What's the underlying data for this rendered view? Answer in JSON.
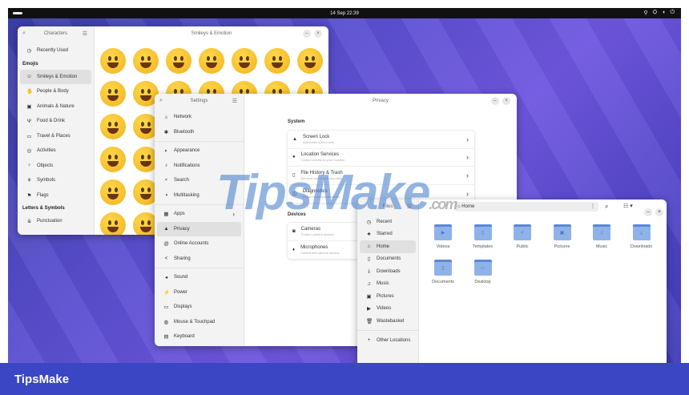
{
  "topbar": {
    "datetime": "14 Sep  22:39",
    "tray": [
      "⚲",
      "⛭",
      "◖",
      "⏻"
    ]
  },
  "characters": {
    "title": "Characters",
    "header": "Smileys & Emotion",
    "recent": "Recently Used",
    "emojis_section": "Emojis",
    "items": [
      {
        "icon": "☺",
        "label": "Smileys & Emotion"
      },
      {
        "icon": "✋",
        "label": "People & Body"
      },
      {
        "icon": "▣",
        "label": "Animals & Nature"
      },
      {
        "icon": "Ψ",
        "label": "Food & Drink"
      },
      {
        "icon": "▭",
        "label": "Travel & Places"
      },
      {
        "icon": "◎",
        "label": "Activities"
      },
      {
        "icon": "♀",
        "label": "Objects"
      },
      {
        "icon": "⚘",
        "label": "Symbols"
      },
      {
        "icon": "⚑",
        "label": "Flags"
      }
    ],
    "letters_section": "Letters & Symbols",
    "punct": "Punctuation"
  },
  "settings": {
    "title": "Settings",
    "header": "Privacy",
    "groups": [
      [
        {
          "icon": "⌂",
          "label": "Network"
        },
        {
          "icon": "✱",
          "label": "Bluetooth"
        }
      ],
      [
        {
          "icon": "◐",
          "label": "Appearance"
        },
        {
          "icon": "♪",
          "label": "Notifications"
        },
        {
          "icon": "⌕",
          "label": "Search"
        },
        {
          "icon": "◑",
          "label": "Multitasking"
        }
      ],
      [
        {
          "icon": "▦",
          "label": "Apps",
          "chev": "›"
        },
        {
          "icon": "▲",
          "label": "Privacy"
        },
        {
          "icon": "@",
          "label": "Online Accounts"
        },
        {
          "icon": "<",
          "label": "Sharing"
        }
      ],
      [
        {
          "icon": "◂",
          "label": "Sound"
        },
        {
          "icon": "⚡",
          "label": "Power"
        },
        {
          "icon": "▭",
          "label": "Displays"
        },
        {
          "icon": "◍",
          "label": "Mouse & Touchpad"
        },
        {
          "icon": "▤",
          "label": "Keyboard"
        }
      ]
    ],
    "system_label": "System",
    "system": [
      {
        "icon": "▲",
        "title": "Screen Lock",
        "sub": "Automatic screen lock"
      },
      {
        "icon": "●",
        "title": "Location Services",
        "sub": "Control access to your location"
      },
      {
        "icon": "▯",
        "title": "File History & Trash",
        "sub": "Remove saved data and files"
      },
      {
        "icon": "◫",
        "title": "Diagnostics",
        "sub": "Report technical problems"
      }
    ],
    "devices_label": "Devices",
    "devices": [
      {
        "icon": "◙",
        "title": "Cameras",
        "sub": "Control camera access"
      },
      {
        "icon": "♦",
        "title": "Microphones",
        "sub": "Control microphone access"
      }
    ]
  },
  "files": {
    "title": "Files",
    "path": "Home",
    "sidebar": [
      {
        "icon": "◷",
        "label": "Recent"
      },
      {
        "icon": "★",
        "label": "Starred"
      },
      {
        "icon": "⌂",
        "label": "Home"
      },
      {
        "icon": "▯",
        "label": "Documents"
      },
      {
        "icon": "⤓",
        "label": "Downloads"
      },
      {
        "icon": "♫",
        "label": "Music"
      },
      {
        "icon": "▣",
        "label": "Pictures"
      },
      {
        "icon": "▶",
        "label": "Videos"
      },
      {
        "icon": "🗑",
        "label": "Wastebasket"
      }
    ],
    "other": "Other Locations",
    "folders": [
      {
        "icon": "▶",
        "label": "Videos"
      },
      {
        "icon": "▯",
        "label": "Templates"
      },
      {
        "icon": "<",
        "label": "Public"
      },
      {
        "icon": "▣",
        "label": "Pictures"
      },
      {
        "icon": "♫",
        "label": "Music"
      },
      {
        "icon": "⤓",
        "label": "Downloads"
      },
      {
        "icon": "▯",
        "label": "Documents"
      },
      {
        "icon": "▭",
        "label": "Desktop"
      }
    ]
  },
  "watermark": {
    "text": "TipsMake",
    ".com": ".com"
  },
  "footer": {
    "brand": "TipsMake"
  }
}
